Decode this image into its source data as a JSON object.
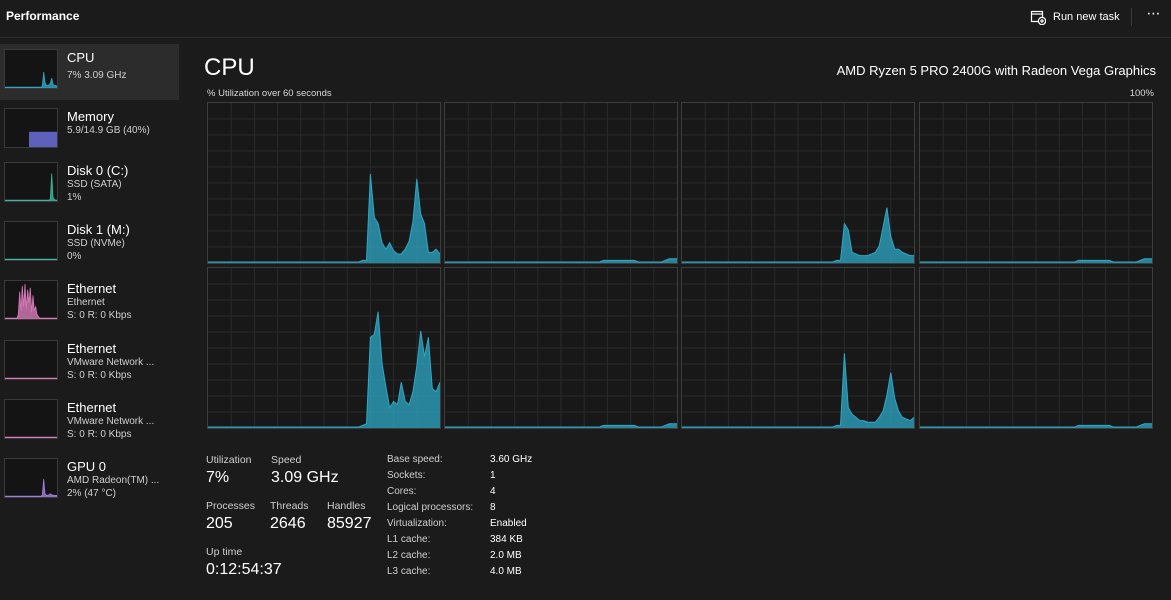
{
  "header": {
    "title": "Performance",
    "run_task_label": "Run new task",
    "more_label": "⋯",
    "icon": "run-task-icon"
  },
  "colors": {
    "background": "#1b1b1b",
    "cpu_accent": "#2ea8c6",
    "memory_accent": "#6b6fd8",
    "disk_accent": "#3fb6a3",
    "ethernet_accent": "#d77bb8",
    "gpu_accent": "#9f7fe0"
  },
  "sidebar": {
    "items": [
      {
        "name": "CPU",
        "line1": "7% 3.09 GHz",
        "line2": "",
        "color": "#2ea8c6",
        "selected": true
      },
      {
        "name": "Memory",
        "line1": "5.9/14.9 GB (40%)",
        "line2": "",
        "color": "#6b6fd8",
        "selected": false
      },
      {
        "name": "Disk 0 (C:)",
        "line1": "SSD (SATA)",
        "line2": "1%",
        "color": "#3fb6a3",
        "selected": false
      },
      {
        "name": "Disk 1 (M:)",
        "line1": "SSD (NVMe)",
        "line2": "0%",
        "color": "#3fb6a3",
        "selected": false
      },
      {
        "name": "Ethernet",
        "line1": "Ethernet",
        "line2": "S: 0 R: 0 Kbps",
        "color": "#d77bb8",
        "selected": false
      },
      {
        "name": "Ethernet",
        "line1": "VMware Network ...",
        "line2": "S: 0 R: 0 Kbps",
        "color": "#d77bb8",
        "selected": false
      },
      {
        "name": "Ethernet",
        "line1": "VMware Network ...",
        "line2": "S: 0 R: 0 Kbps",
        "color": "#d77bb8",
        "selected": false
      },
      {
        "name": "GPU 0",
        "line1": "AMD Radeon(TM) ...",
        "line2": "2% (47 °C)",
        "color": "#9f7fe0",
        "selected": false
      }
    ]
  },
  "main": {
    "title": "CPU",
    "model": "AMD Ryzen 5 PRO 2400G with Radeon Vega Graphics",
    "graph_label": "% Utilization over 60 seconds",
    "graph_max": "100%"
  },
  "stats": {
    "utilization_label": "Utilization",
    "utilization": "7%",
    "speed_label": "Speed",
    "speed": "3.09 GHz",
    "processes_label": "Processes",
    "processes": "205",
    "threads_label": "Threads",
    "threads": "2646",
    "handles_label": "Handles",
    "handles": "85927",
    "uptime_label": "Up time",
    "uptime": "0:12:54:37"
  },
  "specs": [
    {
      "label": "Base speed:",
      "value": "3.60 GHz"
    },
    {
      "label": "Sockets:",
      "value": "1"
    },
    {
      "label": "Cores:",
      "value": "4"
    },
    {
      "label": "Logical processors:",
      "value": "8"
    },
    {
      "label": "Virtualization:",
      "value": "Enabled"
    },
    {
      "label": "L1 cache:",
      "value": "384 KB"
    },
    {
      "label": "L2 cache:",
      "value": "2.0 MB"
    },
    {
      "label": "L3 cache:",
      "value": "4.0 MB"
    }
  ],
  "chart_data": {
    "type": "area",
    "x_range_seconds": [
      0,
      60
    ],
    "ylim": [
      0,
      100
    ],
    "grid": true,
    "series": [
      {
        "values": [
          0,
          0,
          0,
          0,
          0,
          0,
          0,
          0,
          0,
          0,
          0,
          0,
          0,
          0,
          0,
          0,
          0,
          0,
          0,
          0,
          0,
          0,
          0,
          0,
          0,
          0,
          0,
          0,
          0,
          0,
          0,
          0,
          0,
          0,
          0,
          0,
          0,
          0,
          0,
          0,
          1,
          1,
          55,
          28,
          24,
          12,
          8,
          12,
          7,
          5,
          5,
          8,
          13,
          25,
          52,
          30,
          24,
          6,
          6,
          8,
          5
        ]
      },
      {
        "values": [
          0,
          0,
          0,
          0,
          0,
          0,
          0,
          0,
          0,
          0,
          0,
          0,
          0,
          0,
          0,
          0,
          0,
          0,
          0,
          0,
          0,
          0,
          0,
          0,
          0,
          0,
          0,
          0,
          0,
          0,
          0,
          0,
          0,
          0,
          0,
          0,
          0,
          0,
          0,
          0,
          0,
          1,
          1,
          1,
          1,
          1,
          1,
          1,
          1,
          1,
          0,
          0,
          0,
          0,
          0,
          0,
          0,
          1,
          2,
          2,
          2
        ]
      },
      {
        "values": [
          0,
          0,
          0,
          0,
          0,
          0,
          0,
          0,
          0,
          0,
          0,
          0,
          0,
          0,
          0,
          0,
          0,
          0,
          0,
          0,
          0,
          0,
          0,
          0,
          0,
          0,
          0,
          0,
          0,
          0,
          0,
          0,
          0,
          0,
          0,
          0,
          0,
          0,
          0,
          0,
          1,
          1,
          24,
          20,
          6,
          5,
          4,
          4,
          4,
          5,
          6,
          10,
          22,
          34,
          16,
          8,
          8,
          6,
          5,
          4,
          4
        ]
      },
      {
        "values": [
          0,
          0,
          0,
          0,
          0,
          0,
          0,
          0,
          0,
          0,
          0,
          0,
          0,
          0,
          0,
          0,
          0,
          0,
          0,
          0,
          0,
          0,
          0,
          0,
          0,
          0,
          0,
          0,
          0,
          0,
          0,
          0,
          0,
          0,
          0,
          0,
          0,
          0,
          0,
          0,
          0,
          1,
          1,
          1,
          1,
          1,
          1,
          1,
          1,
          1,
          0,
          0,
          0,
          0,
          0,
          0,
          0,
          1,
          2,
          2,
          2
        ]
      },
      {
        "values": [
          0,
          0,
          0,
          0,
          0,
          0,
          0,
          0,
          0,
          0,
          0,
          0,
          0,
          0,
          0,
          0,
          0,
          0,
          0,
          0,
          0,
          0,
          0,
          0,
          0,
          0,
          0,
          0,
          0,
          0,
          0,
          0,
          0,
          0,
          0,
          0,
          0,
          0,
          0,
          0,
          1,
          2,
          56,
          58,
          72,
          40,
          25,
          12,
          16,
          14,
          28,
          16,
          14,
          22,
          38,
          60,
          44,
          56,
          24,
          22,
          28
        ]
      },
      {
        "values": [
          0,
          0,
          0,
          0,
          0,
          0,
          0,
          0,
          0,
          0,
          0,
          0,
          0,
          0,
          0,
          0,
          0,
          0,
          0,
          0,
          0,
          0,
          0,
          0,
          0,
          0,
          0,
          0,
          0,
          0,
          0,
          0,
          0,
          0,
          0,
          0,
          0,
          0,
          0,
          0,
          0,
          1,
          1,
          1,
          1,
          1,
          1,
          1,
          1,
          1,
          0,
          0,
          0,
          0,
          0,
          0,
          0,
          1,
          2,
          2,
          2
        ]
      },
      {
        "values": [
          0,
          0,
          0,
          0,
          0,
          0,
          0,
          0,
          0,
          0,
          0,
          0,
          0,
          0,
          0,
          0,
          0,
          0,
          0,
          0,
          0,
          0,
          0,
          0,
          0,
          0,
          0,
          0,
          0,
          0,
          0,
          0,
          0,
          0,
          0,
          0,
          0,
          0,
          0,
          0,
          1,
          1,
          46,
          12,
          8,
          6,
          4,
          4,
          3,
          3,
          3,
          6,
          10,
          20,
          34,
          18,
          10,
          6,
          5,
          4,
          6
        ]
      },
      {
        "values": [
          0,
          0,
          0,
          0,
          0,
          0,
          0,
          0,
          0,
          0,
          0,
          0,
          0,
          0,
          0,
          0,
          0,
          0,
          0,
          0,
          0,
          0,
          0,
          0,
          0,
          0,
          0,
          0,
          0,
          0,
          0,
          0,
          0,
          0,
          0,
          0,
          0,
          0,
          0,
          0,
          0,
          1,
          1,
          1,
          1,
          1,
          1,
          1,
          1,
          1,
          0,
          0,
          0,
          0,
          0,
          0,
          0,
          1,
          2,
          2,
          2
        ]
      }
    ]
  }
}
